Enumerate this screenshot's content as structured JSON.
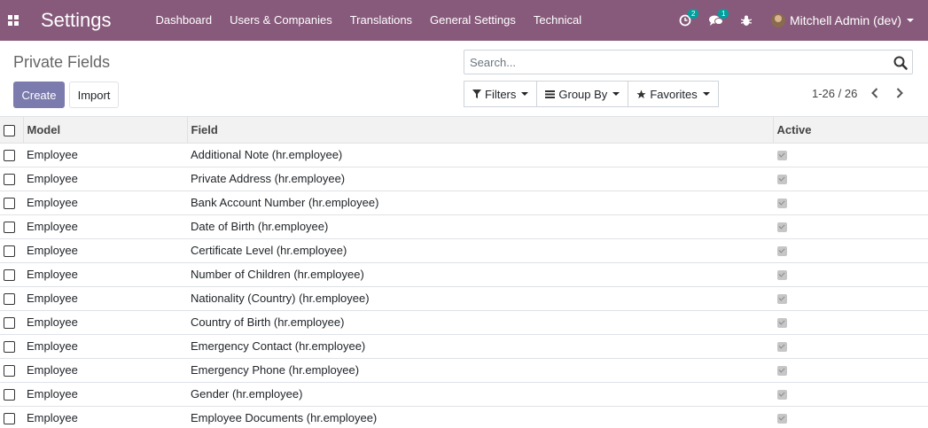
{
  "app": {
    "title": "Settings",
    "menu": [
      "Dashboard",
      "Users & Companies",
      "Translations",
      "General Settings",
      "Technical"
    ],
    "activities_count": "2",
    "messages_count": "1",
    "user_name": "Mitchell Admin (dev)"
  },
  "control_panel": {
    "breadcrumb": "Private Fields",
    "create_label": "Create",
    "import_label": "Import",
    "search_placeholder": "Search...",
    "filters_label": "Filters",
    "group_by_label": "Group By",
    "favorites_label": "Favorites",
    "pager": "1-26 / 26"
  },
  "table": {
    "columns": [
      "Model",
      "Field",
      "Active"
    ],
    "rows": [
      {
        "model": "Employee",
        "field": "Additional Note (hr.employee)",
        "active": true
      },
      {
        "model": "Employee",
        "field": "Private Address (hr.employee)",
        "active": true
      },
      {
        "model": "Employee",
        "field": "Bank Account Number (hr.employee)",
        "active": true
      },
      {
        "model": "Employee",
        "field": "Date of Birth (hr.employee)",
        "active": true
      },
      {
        "model": "Employee",
        "field": "Certificate Level (hr.employee)",
        "active": true
      },
      {
        "model": "Employee",
        "field": "Number of Children (hr.employee)",
        "active": true
      },
      {
        "model": "Employee",
        "field": "Nationality (Country) (hr.employee)",
        "active": true
      },
      {
        "model": "Employee",
        "field": "Country of Birth (hr.employee)",
        "active": true
      },
      {
        "model": "Employee",
        "field": "Emergency Contact (hr.employee)",
        "active": true
      },
      {
        "model": "Employee",
        "field": "Emergency Phone (hr.employee)",
        "active": true
      },
      {
        "model": "Employee",
        "field": "Gender (hr.employee)",
        "active": true
      },
      {
        "model": "Employee",
        "field": "Employee Documents (hr.employee)",
        "active": true
      }
    ]
  },
  "colors": {
    "navbar": "#875a7b",
    "primary_button": "#7c7bad",
    "badge": "#00a09d"
  }
}
